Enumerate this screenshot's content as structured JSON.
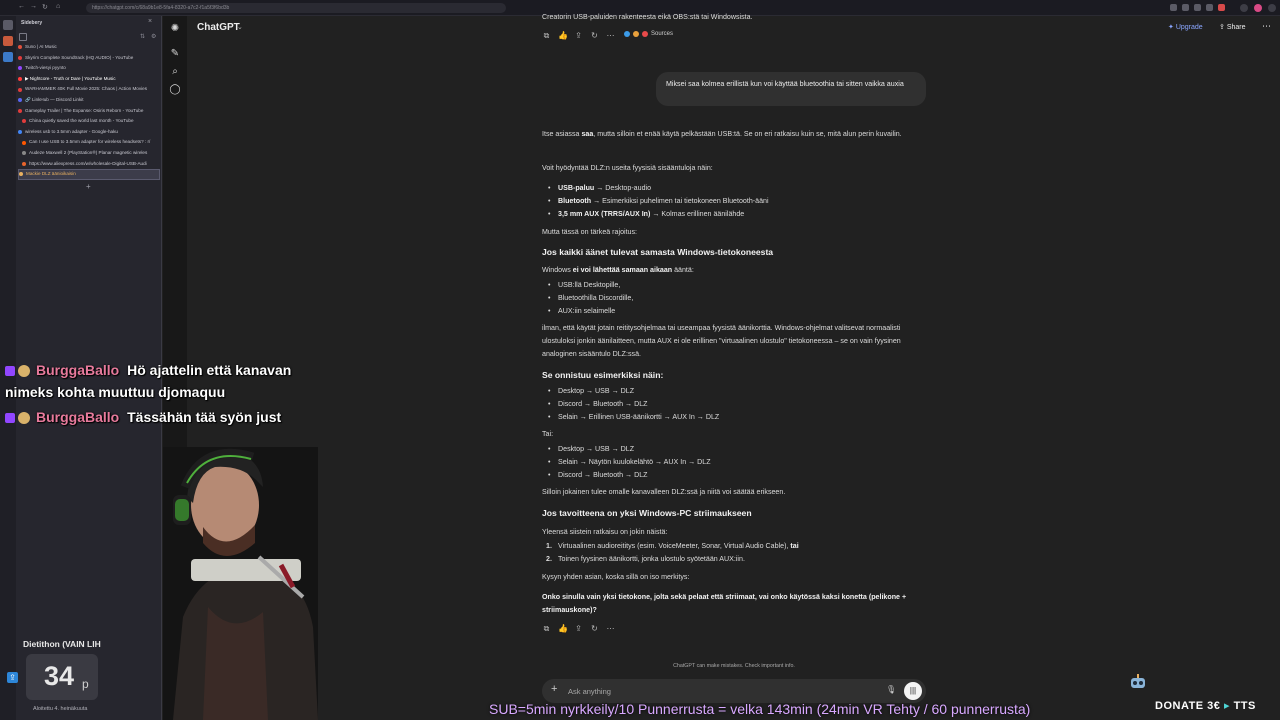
{
  "browser": {
    "url": "https://chatgpt.com/c/68a9b1e8-5fa4-8320-a7c2-f1a5f3f6bd3b"
  },
  "sidebery": {
    "title": "Sidebery",
    "tabs": [
      {
        "label": "Suno | AI Music",
        "color": "#e0503c"
      },
      {
        "label": "Skyrim Complete Soundtrack (HQ AUDIO) - YouTube",
        "color": "#e03c3c"
      },
      {
        "label": "Twitch-viesyi pyynto",
        "color": "#9146ff"
      },
      {
        "label": "▶ Nightcore - Truth or Dare | YouTube Music",
        "color": "#ff3c3c"
      },
      {
        "label": "WARHAMMER 40K Full Movie 2025: Chaos | Action Movies",
        "color": "#e03c3c"
      },
      {
        "label": "🔗 LinkHub — Discord Linkit",
        "color": "#5865f2"
      },
      {
        "label": "Gameplay Trailer | The Expanse: Osiris Reborn - YouTube",
        "color": "#e03c3c"
      },
      {
        "label": "China quietly saved the world last month - YouTube",
        "color": "#e03c3c"
      },
      {
        "label": "wireless usb to 3.5mm adapter - Google-haku",
        "color": "#4285f4"
      },
      {
        "label": "Can I use USB to 3.5mm adapter for wireless headsets? : r/",
        "color": "#ff5700"
      },
      {
        "label": "Audeze Maxwell 2 (PlayStation®) Planar magnetic wireles",
        "color": "#888888"
      },
      {
        "label": "https://www.aliexpress.com/w/wholesale-Digital-USB-Audi",
        "color": "#e8642c"
      },
      {
        "label": "Mackie DLZ äänioikaisin",
        "color": "#e8b060"
      }
    ]
  },
  "stream_panel": {
    "title": "Dietithon (VAIN LIH",
    "value": "34",
    "unit": "p",
    "footer": "Aloitettu 4. heinäkuuta"
  },
  "chatgpt": {
    "app_title": "ChatGPT",
    "upgrade_label": "Upgrade",
    "share_label": "Share",
    "prev_answer_tail": "Creatorin USB-paluiden rakenteesta eikä OBS:stä tai Windowsista.",
    "sources_label": "Sources",
    "user_message": "Miksei saa kolmea erillistä kun voi käyttää bluetoothia tai sitten vaikka auxia",
    "answer": {
      "intro_a": "Itse asiassa ",
      "intro_b": "saa",
      "intro_c": ", mutta silloin et enää käytä pelkästään USB:tä. Se on eri ratkaisu kuin se, mitä alun perin kuvailin.",
      "inputs_lead": "Voit hyödyntää DLZ:n useita fyysisiä sisääntuloja näin:",
      "inputs": [
        {
          "bold": "USB-paluu",
          "rest": " → Desktop-audio"
        },
        {
          "bold": "Bluetooth",
          "rest": " → Esimerkiksi puhelimen tai tietokoneen Bluetooth-ääni"
        },
        {
          "bold": "3,5 mm AUX (TRRS/AUX In)",
          "rest": " → Kolmas erillinen äänilähde"
        }
      ],
      "limit_lead": "Mutta tässä on tärkeä rajoitus:",
      "heading1": "Jos kaikki äänet tulevat samasta Windows-tietokoneesta",
      "windows_a": "Windows ",
      "windows_b": "ei voi lähettää samaan aikaan",
      "windows_c": " ääntä:",
      "routes": [
        "USB:llä Desktopille,",
        "Bluetoothilla Discordille,",
        "AUX:iin selaimelle"
      ],
      "para2": "ilman, että käytät jotain reititysohjelmaa tai useampaa fyysistä äänikorttia. Windows-ohjelmat valitsevat normaalisti ulostuloksi jonkin äänilaitteen, mutta AUX ei ole erillinen \"virtuaalinen ulostulo\" tietokoneessa – se on vain fyysinen analoginen sisääntulo DLZ:ssä.",
      "heading2": "Se onnistuu esimerkiksi näin:",
      "example1": [
        "Desktop → USB → DLZ",
        "Discord → Bluetooth → DLZ",
        "Selain → Erillinen USB-äänikortti → AUX In → DLZ"
      ],
      "or_label": "Tai:",
      "example2": [
        "Desktop → USB → DLZ",
        "Selain → Näytön kuulokelähtö → AUX In → DLZ",
        "Discord → Bluetooth → DLZ"
      ],
      "result": "Silloin jokainen tulee omalle kanavalleen DLZ:ssä ja niitä voi säätää erikseen.",
      "heading3": "Jos tavoitteena on yksi Windows-PC striimaukseen",
      "solution_lead": "Yleensä siistein ratkaisu on jokin näistä:",
      "solutions": [
        {
          "num": "1.",
          "text": "Virtuaalinen audioreititys (esim. VoiceMeeter, Sonar, Virtual Audio Cable), ",
          "bold": "tai"
        },
        {
          "num": "2.",
          "text": "Toinen fyysinen äänikortti, jonka ulostulo syötetään AUX:iin.",
          "bold": ""
        }
      ],
      "ask_lead": "Kysyn yhden asian, koska sillä on iso merkitys:",
      "question": "Onko sinulla vain yksi tietokone, jolta sekä pelaat että striimaat, vai onko käytössä kaksi konetta (pelikone + striimauskone)?"
    },
    "disclaimer": "ChatGPT can make mistakes. Check important info.",
    "composer_placeholder": "Ask anything"
  },
  "chat_overlay": [
    {
      "user": "BurggaBallo",
      "message": "Hö ajattelin että kanavan",
      "message_cont": "nimeks kohta muuttuu djomaquu"
    },
    {
      "user": "BurggaBallo",
      "message": "Tässähän tää syön just",
      "message_cont": ""
    }
  ],
  "ticker": "SUB=5min nyrkkeily/10 Punnerrusta = velka 143min (24min VR Tehty / 60 punnerrusta)",
  "donate": {
    "label": "DONATE 3€",
    "arrow": "▸",
    "suffix": "TTS"
  },
  "icons": {
    "rail": [
      "chatgpt-logo-icon",
      "new-chat-icon",
      "search-icon",
      "library-icon"
    ],
    "actions": [
      "copy-icon",
      "thumbs-icon",
      "share-icon",
      "regenerate-icon",
      "more-icon"
    ]
  }
}
